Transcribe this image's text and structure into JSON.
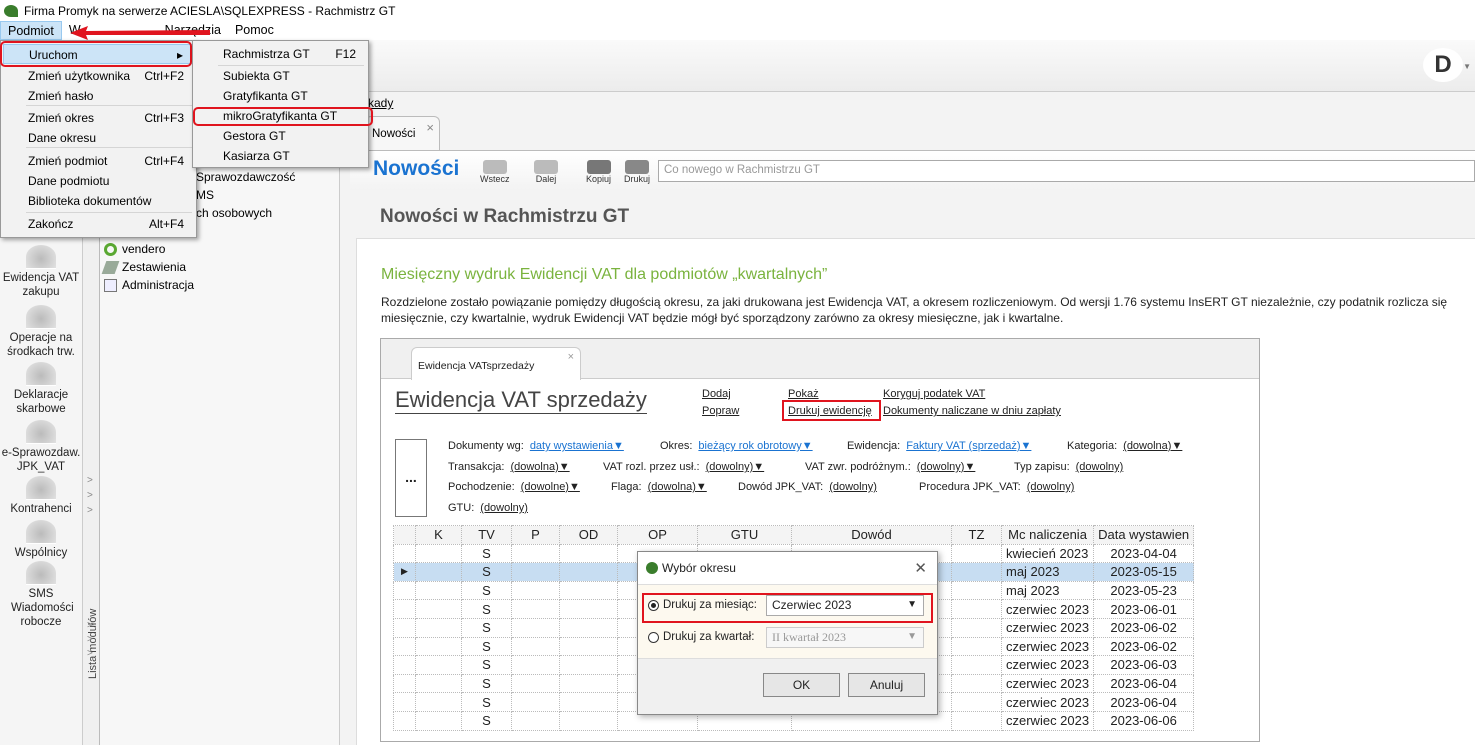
{
  "window": {
    "title": "Firma Promyk na serwerze ACIESLA\\SQLEXPRESS - Rachmistrz GT",
    "logo": "GT"
  },
  "menubar": [
    "Podmiot",
    "W",
    "Narzędzia",
    "Pomoc"
  ],
  "podmiot_menu": [
    {
      "label": "Uruchom",
      "shortcut": ""
    },
    {
      "label": "Zmień użytkownika",
      "shortcut": "Ctrl+F2"
    },
    {
      "label": "Zmień hasło",
      "shortcut": ""
    },
    {
      "label": "Zmień okres",
      "shortcut": "Ctrl+F3"
    },
    {
      "label": "Dane okresu",
      "shortcut": ""
    },
    {
      "label": "Zmień podmiot",
      "shortcut": "Ctrl+F4"
    },
    {
      "label": "Dane podmiotu",
      "shortcut": ""
    },
    {
      "label": "Biblioteka dokumentów",
      "shortcut": ""
    },
    {
      "label": "Zakończ",
      "shortcut": "Alt+F4"
    }
  ],
  "uruchom_submenu": [
    {
      "label": "Rachmistrza GT",
      "shortcut": "F12"
    },
    {
      "label": "Subiekta GT"
    },
    {
      "label": "Gratyfikanta GT"
    },
    {
      "label": "mikroGratyfikanta GT"
    },
    {
      "label": "Gestora GT"
    },
    {
      "label": "Kasiarza GT"
    }
  ],
  "user_avatar": "D",
  "modules": [
    "Ewidencja VAT zakupu",
    "Operacje na środkach trw.",
    "Deklaracje skarbowe",
    "e-Sprawozdaw. JPK_VAT",
    "Kontrahenci",
    "Wspólnicy",
    "SMS Wiadomości robocze"
  ],
  "module_list_label": "Lista modułów",
  "tree": {
    "partial": [
      "Sprawozdawczość",
      "MS",
      "ch osobowych"
    ],
    "items": [
      "vendero",
      "Zestawienia",
      "Administracja"
    ]
  },
  "zakladki_link": "kady",
  "tab": {
    "label": "Nowości",
    "close": "×"
  },
  "header": {
    "title": "Nowości",
    "back": "Wstecz",
    "forward": "Dalej",
    "copy": "Kopiuj",
    "print": "Drukuj",
    "search_placeholder": "Co nowego w Rachmistrzu GT"
  },
  "content": {
    "title": "Nowości w Rachmistrzu GT",
    "heading": "Miesięczny wydruk Ewidencji VAT dla podmiotów „kwartalnych”",
    "paragraph": "Rozdzielone zostało powiązanie pomiędzy długością okresu, za jaki drukowana jest Ewidencja VAT, a okresem rozliczeniowym. Od wersji 1.76 systemu InsERT GT niezależnie, czy podatnik rozlicza się miesięcznie, czy kwartalnie, wydruk Ewidencji VAT będzie mógł być sporządzony zarówno za okresy miesięczne, jak i kwartalne."
  },
  "shot": {
    "tab": "Ewidencja VATsprzedaży",
    "tab_close": "×",
    "title": "Ewidencja VAT sprzedaży",
    "links": [
      "Dodaj",
      "Popraw",
      "Pokaż",
      "Drukuj ewidencję",
      "Koryguj podatek VAT",
      "Dokumenty naliczane w dniu zapłaty"
    ],
    "more": "...",
    "filters": [
      {
        "label": "Dokumenty wg:",
        "value": "daty wystawienia▼"
      },
      {
        "label": "Okres:",
        "value": "bieżący rok obrotowy▼"
      },
      {
        "label": "Ewidencja:",
        "value": "Faktury VAT (sprzedaż)▼"
      },
      {
        "label": "Kategoria:",
        "value": "(dowolna)▼"
      },
      {
        "label": "Transakcja:",
        "value": "(dowolna)▼"
      },
      {
        "label": "VAT rozl. przez usł.:",
        "value": "(dowolny)▼"
      },
      {
        "label": "VAT zwr. podróżnym.:",
        "value": "(dowolny)▼"
      },
      {
        "label": "Typ zapisu:",
        "value": "(dowolny)"
      },
      {
        "label": "Pochodzenie:",
        "value": "(dowolne)▼"
      },
      {
        "label": "Flaga:",
        "value": "(dowolna)▼"
      },
      {
        "label": "Dowód JPK_VAT:",
        "value": "(dowolny)"
      },
      {
        "label": "Procedura JPK_VAT:",
        "value": "(dowolny)"
      },
      {
        "label": "GTU:",
        "value": "(dowolny)"
      }
    ],
    "columns": [
      "",
      "K",
      "TV",
      "P",
      "OD",
      "OP",
      "GTU",
      "Dowód",
      "TZ",
      "Mc naliczenia",
      "Data wystawien"
    ],
    "rows": [
      [
        "S",
        "kwiecień 2023",
        "2023-04-04"
      ],
      [
        "S",
        "maj 2023",
        "2023-05-15"
      ],
      [
        "S",
        "maj 2023",
        "2023-05-23"
      ],
      [
        "S",
        "czerwiec 2023",
        "2023-06-01"
      ],
      [
        "S",
        "czerwiec 2023",
        "2023-06-02"
      ],
      [
        "S",
        "czerwiec 2023",
        "2023-06-02"
      ],
      [
        "S",
        "czerwiec 2023",
        "2023-06-03"
      ],
      [
        "S",
        "czerwiec 2023",
        "2023-06-04"
      ],
      [
        "S",
        "czerwiec 2023",
        "2023-06-04"
      ],
      [
        "S",
        "czerwiec 2023",
        "2023-06-06"
      ]
    ],
    "selected_row": 1,
    "dialog": {
      "title": "Wybór okresu",
      "month_label": "Drukuj za miesiąc:",
      "month_value": "Czerwiec 2023",
      "quarter_label": "Drukuj za kwartał:",
      "quarter_value": "II kwartał 2023",
      "ok": "OK",
      "cancel": "Anuluj"
    }
  },
  "colors": {
    "accent": "#1a73d1",
    "highlight_red": "#e0141e",
    "green_heading": "#7ab33e",
    "selection": "#cce4f7"
  }
}
